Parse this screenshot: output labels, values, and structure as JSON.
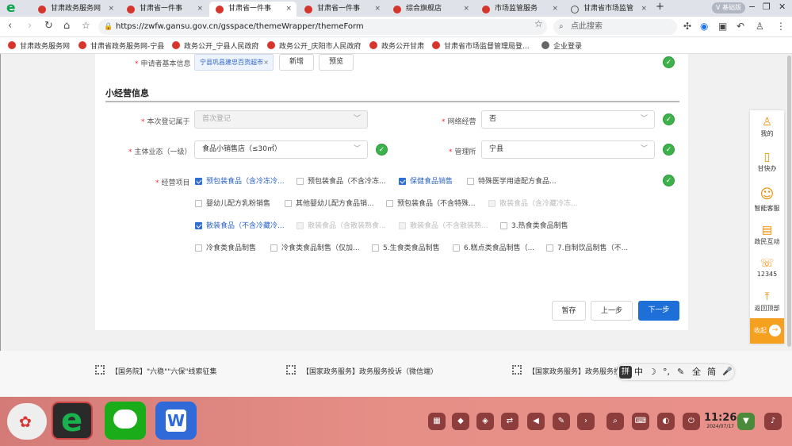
{
  "browser": {
    "tabs": [
      {
        "title": "甘肃政务服务网"
      },
      {
        "title": "甘肃省一件事"
      },
      {
        "title": "甘肃省一件事"
      },
      {
        "title": "甘肃省一件事"
      },
      {
        "title": "综合旗舰店"
      },
      {
        "title": "市场监管服务"
      },
      {
        "title": "甘肃省市场监管"
      }
    ],
    "badge": "基础版",
    "url": "https://zwfw.gansu.gov.cn/gsspace/themeWrapper/themeForm",
    "search_placeholder": "点此搜索",
    "bookmarks": [
      "甘肃政务服务网",
      "甘肃省政务服务网-宁县",
      "政务公开_宁县人民政府",
      "政务公开_庆阳市人民政府",
      "政务公开甘肃",
      "甘肃省市场监督管理局登...",
      "企业登录"
    ]
  },
  "form": {
    "applicant_label": "申请者基本信息",
    "applicant_tag": "宁县巩昌建忠百货超市",
    "add_button": "新增",
    "preview_button": "预览",
    "section_title": "小经营信息",
    "registration_label": "本次登记属于",
    "registration_value": "首次登记",
    "online_label": "网络经营",
    "online_value": "否",
    "business_type_label": "主体业态（一级）",
    "business_type_value": "食品小销售店（≤30㎡）",
    "admin_label": "管理所",
    "admin_value": "宁县",
    "items_label": "经营项目",
    "items": [
      {
        "label": "预包装食品（含冷冻冷...",
        "state": "on"
      },
      {
        "label": "预包装食品（不含冷冻...",
        "state": "off"
      },
      {
        "label": "保健食品销售",
        "state": "on"
      },
      {
        "label": "特殊医学用途配方食品...",
        "state": "off"
      },
      {
        "label": "婴幼儿配方乳粉销售",
        "state": "off"
      },
      {
        "label": "其他婴幼儿配方食品销...",
        "state": "off"
      },
      {
        "label": "预包装食品（不含特殊...",
        "state": "off"
      },
      {
        "label": "散装食品（含冷藏冷冻...",
        "state": "dis"
      },
      {
        "label": "散装食品（不含冷藏冷...",
        "state": "on"
      },
      {
        "label": "散装食品（含散装熟食...",
        "state": "dis"
      },
      {
        "label": "散装食品（不含散装熟...",
        "state": "dis"
      },
      {
        "label": "3.热食类食品制售",
        "state": "off"
      },
      {
        "label": "冷食类食品制售",
        "state": "off"
      },
      {
        "label": "冷食类食品制售（仅加...",
        "state": "off"
      },
      {
        "label": "5.生食类食品制售",
        "state": "off"
      },
      {
        "label": "6.糕点类食品制售（...",
        "state": "off"
      },
      {
        "label": "7.自制饮品制售（不...",
        "state": "off"
      }
    ],
    "save_button": "暂存",
    "prev_button": "上一步",
    "next_button": "下一步"
  },
  "sidepanel": {
    "items": [
      "我的",
      "甘快办",
      "智能客服",
      "政民互动",
      "12345",
      "返回顶部"
    ],
    "collapse": "收起"
  },
  "footer": {
    "links": [
      "【国务院】\"六稳\"\"六保\"线索征集",
      "【国家政务服务】政务服务投诉（微信端）",
      "【国家政务服务】政务服务投诉"
    ]
  },
  "ime": {
    "items": [
      "拼",
      "中",
      "☽",
      "°,",
      "✎",
      "全",
      "简",
      "🎤"
    ]
  },
  "taskbar": {
    "time": "11:26",
    "date": "2024/07/17"
  }
}
